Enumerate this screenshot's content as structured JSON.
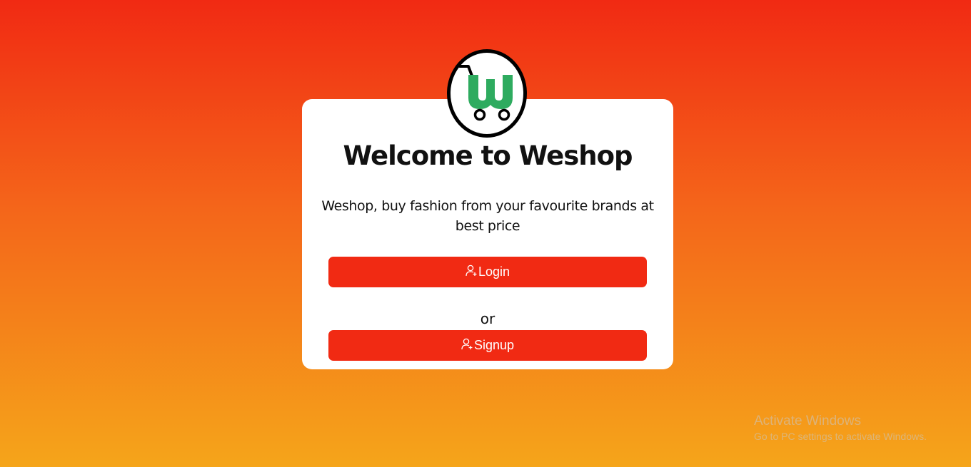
{
  "brand": {
    "logo_icon": "cart-w-logo-icon",
    "logo_color": "#2eab5f"
  },
  "welcome": {
    "title": "Welcome to Weshop",
    "tagline": "Weshop, buy fashion from your favourite brands at best price"
  },
  "actions": {
    "login_label": "Login",
    "login_icon": "user-add-icon",
    "or_text": "or",
    "signup_label": "Signup",
    "signup_icon": "user-add-icon",
    "button_color": "#f12a13"
  },
  "watermark": {
    "title": "Activate Windows",
    "subtitle": "Go to PC settings to activate Windows."
  }
}
